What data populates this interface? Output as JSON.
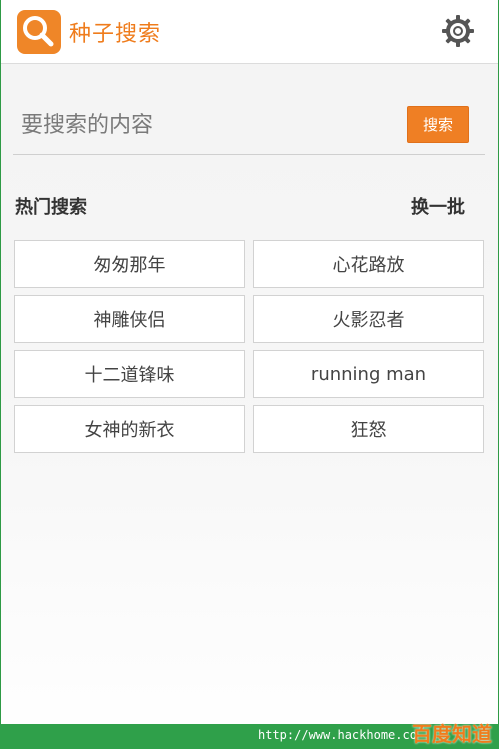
{
  "header": {
    "title": "种子搜索",
    "app_icon": "search-icon",
    "settings_icon": "gear-icon"
  },
  "search": {
    "placeholder": "要搜索的内容",
    "button_label": "搜索"
  },
  "hot": {
    "title": "热门搜索",
    "refresh_label": "换一批",
    "items": [
      "匆匆那年",
      "心花路放",
      "神雕侠侣",
      "火影忍者",
      "十二道锋味",
      "running man",
      "女神的新衣",
      "狂怒"
    ]
  },
  "footer": {
    "url": "http://www.hackhome.co",
    "watermark": "百度知道"
  },
  "colors": {
    "accent": "#ef7f24",
    "border_green": "#2fa04a"
  }
}
